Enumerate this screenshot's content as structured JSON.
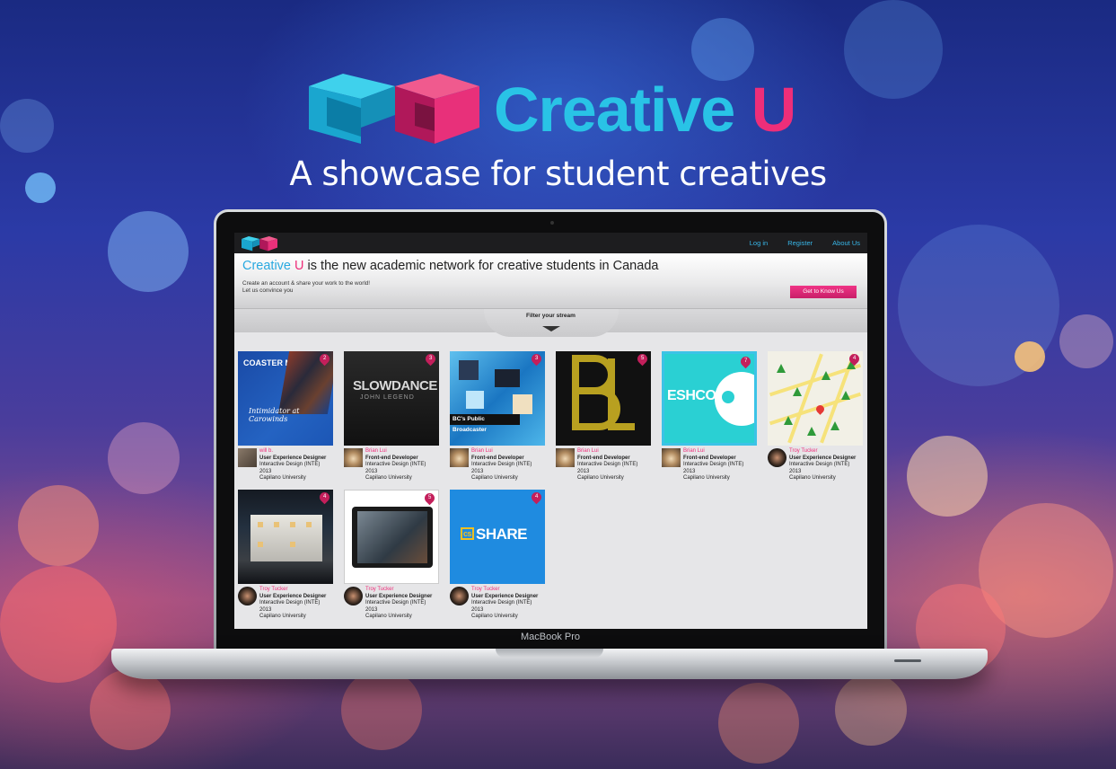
{
  "hero": {
    "brand_part1": "Creative ",
    "brand_part2": "U",
    "tagline": "A showcase for student creatives"
  },
  "colors": {
    "brand_cyan": "#29c3e6",
    "brand_pink": "#ee2e79",
    "link_blue": "#38b6e8"
  },
  "laptop": {
    "model_label": "MacBook Pro"
  },
  "nav": {
    "links": [
      {
        "label": "Log in"
      },
      {
        "label": "Register"
      },
      {
        "label": "About Us"
      }
    ]
  },
  "banner": {
    "headline_brand_1": "Creative ",
    "headline_brand_2": "U",
    "headline_rest": " is the new academic network for creative students in Canada",
    "sub_line1": "Create an account & share your work to the world!",
    "sub_line2": "Let us convince you",
    "cta_label": "Get to Know Us"
  },
  "filter": {
    "label": "Filter your stream"
  },
  "cards": [
    {
      "thumb_text": "COASTER MADNESS",
      "thumb_sub": "Intimidator at Carowinds",
      "badge": "2",
      "name": "will b.",
      "role": "User Experience Designer",
      "program": "Interactive Design (INTE) 2013",
      "school": "Capilano University"
    },
    {
      "thumb_text": "SLOWDANCE",
      "thumb_sub": "JOHN LEGEND",
      "badge": "3",
      "name": "Brian Lui",
      "role": "Front-end Developer",
      "program": "Interactive Design (INTE) 2013",
      "school": "Capilano University"
    },
    {
      "thumb_text": "BC's Public Broadcaster",
      "badge": "3",
      "name": "Brian Lui",
      "role": "Front-end Developer",
      "program": "Interactive Design (INTE) 2013",
      "school": "Capilano University"
    },
    {
      "badge": "5",
      "name": "Brian Lui",
      "role": "Front-end Developer",
      "program": "Interactive Design (INTE) 2013",
      "school": "Capilano University"
    },
    {
      "thumb_text": "ESHCO",
      "badge": "7",
      "name": "Brian Lui",
      "role": "Front-end Developer",
      "program": "Interactive Design (INTE) 2013",
      "school": "Capilano University"
    },
    {
      "badge": "4",
      "name": "Troy Tucker",
      "role": "User Experience Designer",
      "program": "Interactive Design (INTE) 2013",
      "school": "Capilano University"
    },
    {
      "badge": "4",
      "name": "Troy Tucker",
      "role": "User Experience Designer",
      "program": "Interactive Design (INTE) 2013",
      "school": "Capilano University"
    },
    {
      "badge": "5",
      "name": "Troy Tucker",
      "role": "User Experience Designer",
      "program": "Interactive Design (INTE) 2013",
      "school": "Capilano University"
    },
    {
      "thumb_text": "SHARE",
      "badge": "4",
      "name": "Troy Tucker",
      "role": "User Experience Designer",
      "program": "Interactive Design (INTE) 2013",
      "school": "Capilano University"
    }
  ]
}
